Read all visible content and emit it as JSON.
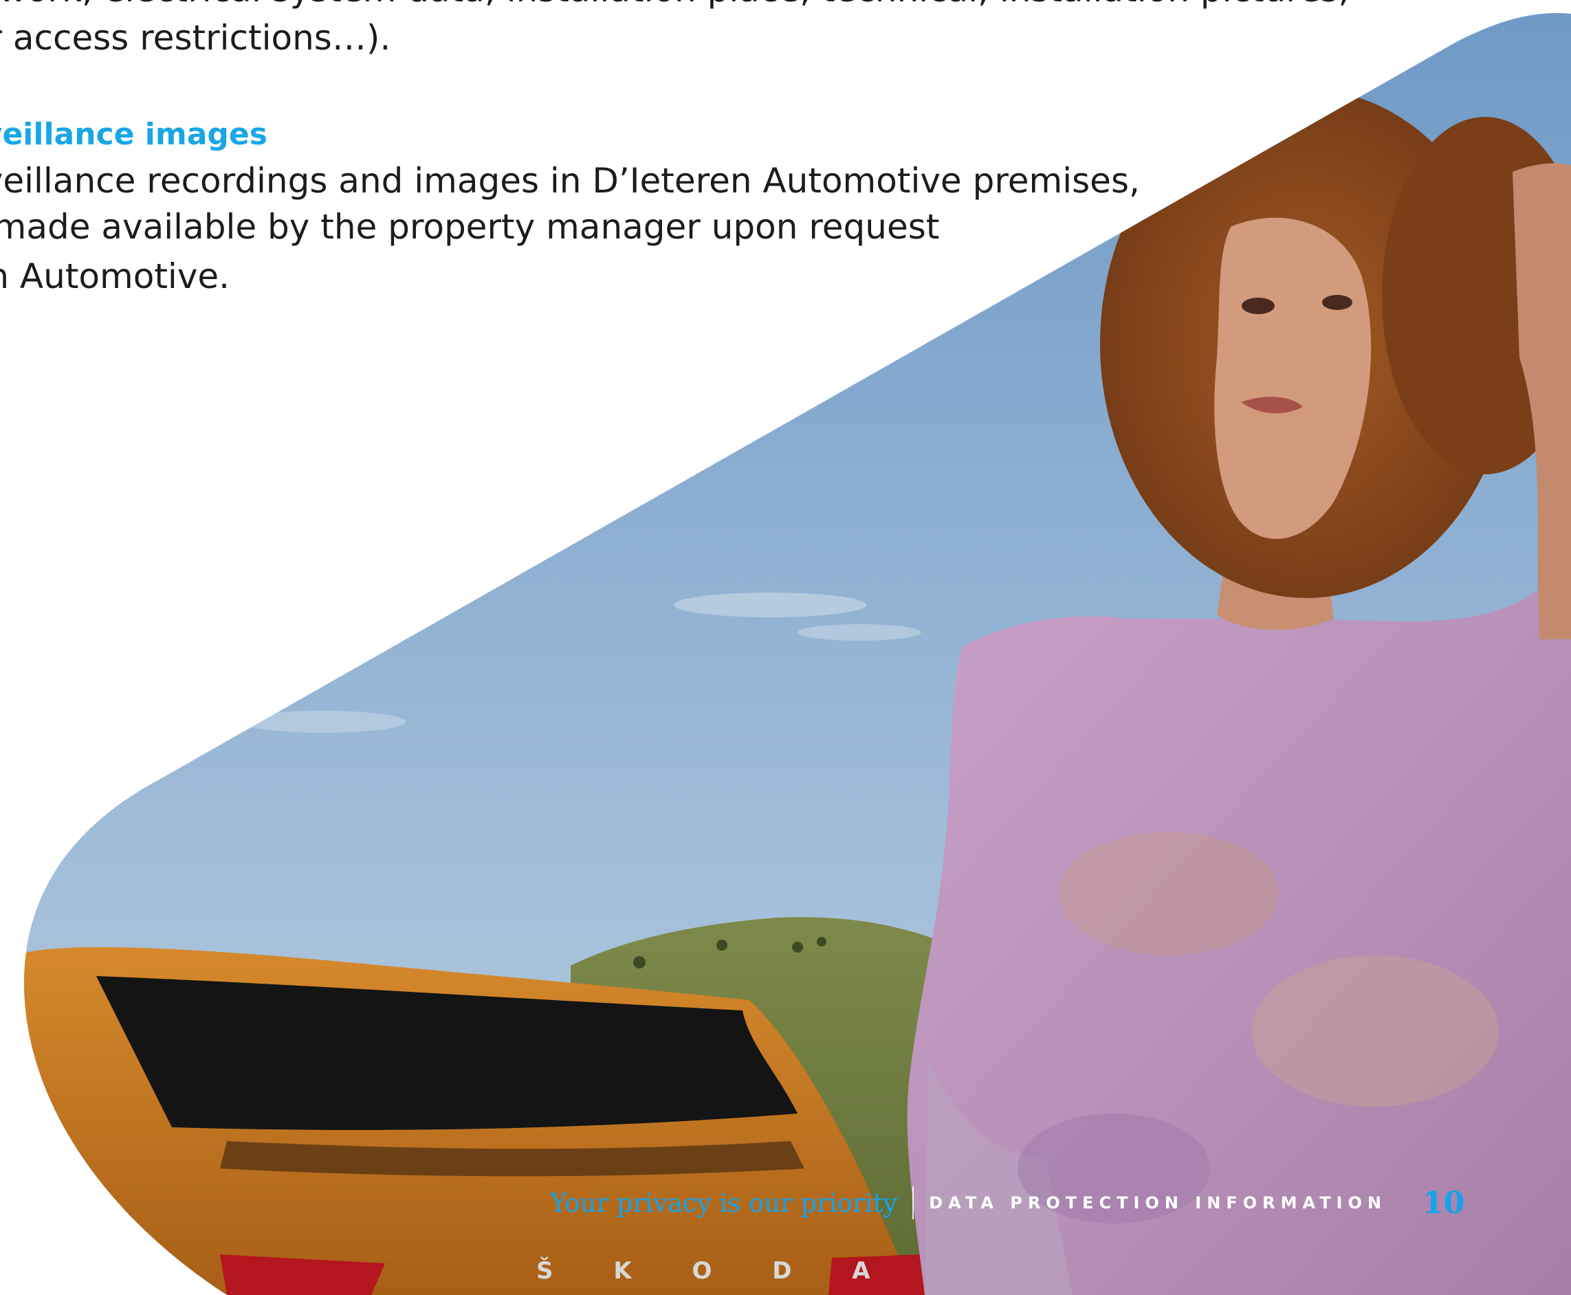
{
  "document": {
    "cut_top_line": "… network, electrical system data, installation place, technical, installation pictures,",
    "line_1": "ical or access restrictions…).",
    "heading": "o surveillance images",
    "paragraph_lines": [
      "o surveillance recordings and images in D’Ieteren Automotive premises,",
      "ar as made available by the property manager upon request",
      "eteren Automotive."
    ]
  },
  "photo": {
    "car_badge": "Š K O D A"
  },
  "footer": {
    "tagline": "Your privacy is our priority",
    "section": "DATA PROTECTION INFORMATION",
    "page_number": "10"
  },
  "colors": {
    "accent_blue": "#19a6e6",
    "text": "#1c1c1c",
    "sky": "#8fb1d3",
    "car_orange": "#c3761f"
  }
}
